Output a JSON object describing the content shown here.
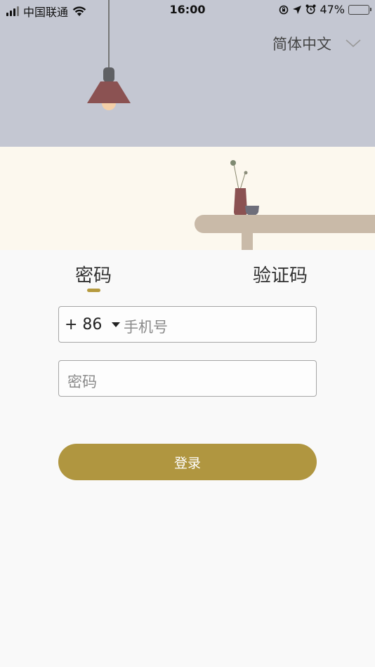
{
  "status_bar": {
    "carrier": "中国联通",
    "time": "16:00",
    "battery_percent": "47%",
    "battery_level": 0.47
  },
  "language": {
    "selected": "简体中文"
  },
  "tabs": [
    {
      "label": "密码",
      "active": true
    },
    {
      "label": "验证码",
      "active": false
    }
  ],
  "phone": {
    "country_code": "+ 86",
    "placeholder": "手机号",
    "value": ""
  },
  "password": {
    "placeholder": "密码",
    "value": ""
  },
  "login_button": {
    "label": "登录"
  },
  "colors": {
    "accent": "#b09640",
    "hero_top": "#c4c7d2",
    "hero_bottom": "#fcf8ee",
    "lamp_shade": "#8b5252",
    "table": "#c9baa8"
  }
}
